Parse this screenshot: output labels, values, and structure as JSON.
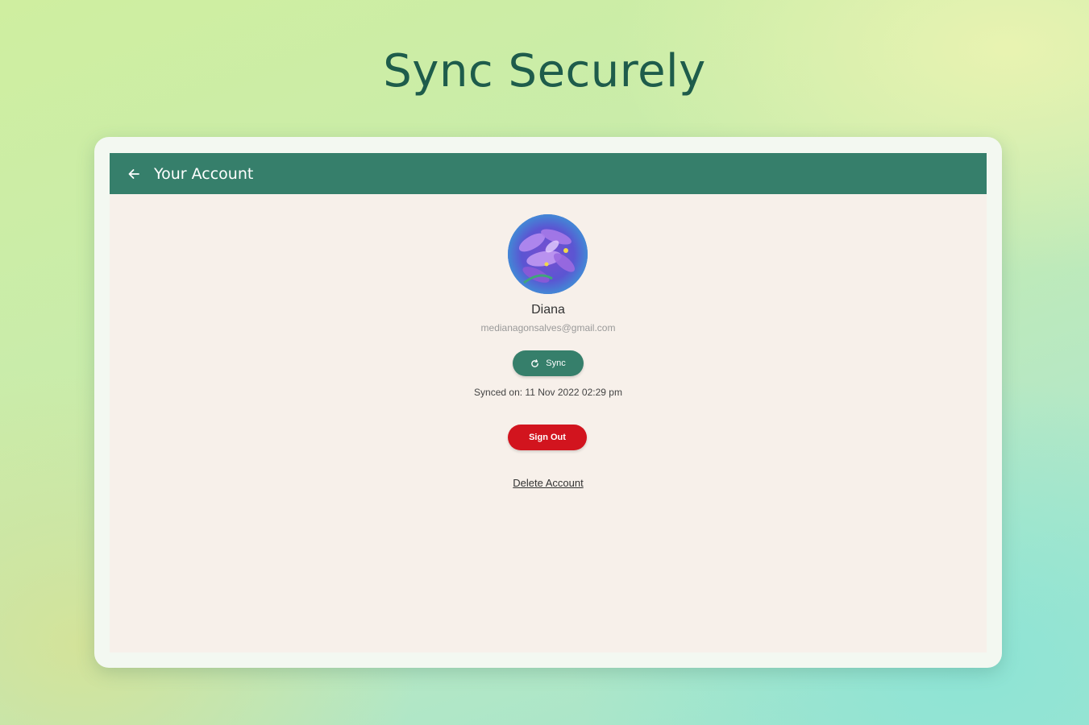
{
  "headline": "Sync Securely",
  "appbar": {
    "title": "Your Account",
    "back_icon": "arrow-left-icon"
  },
  "profile": {
    "name": "Diana",
    "email": "medianagonsalves@gmail.com",
    "avatar_image": "purple-flower"
  },
  "actions": {
    "sync_label": "Sync",
    "sync_icon": "sync-icon",
    "synced_on": "Synced on: 11 Nov 2022 02:29 pm",
    "signout_label": "Sign Out",
    "delete_label": "Delete Account"
  },
  "colors": {
    "primary": "#367f6b",
    "danger": "#d2141e",
    "headline": "#1e5c4b",
    "screen_bg": "#f7f0ea"
  }
}
